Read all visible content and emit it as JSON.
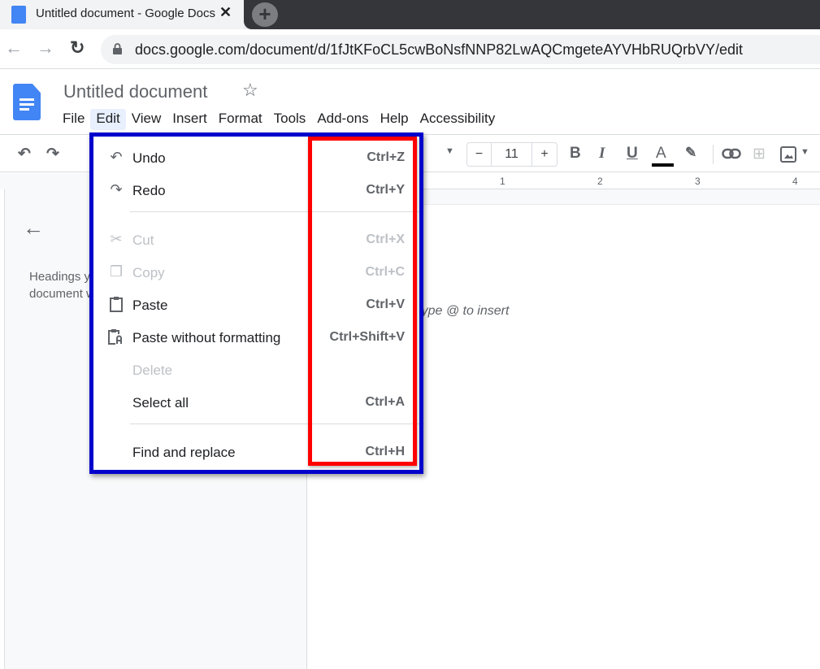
{
  "browser": {
    "tab_title": "Untitled document - Google Docs",
    "new_tab": "+",
    "close": "✕",
    "back": "←",
    "forward": "→",
    "reload": "↻",
    "url": "docs.google.com/document/d/1fJtKFoCL5cwBoNsfNNP82LwAQCmgeteAYVHbRUQrbVY/edit"
  },
  "doc": {
    "title": "Untitled document",
    "star": "☆",
    "menu": [
      "File",
      "Edit",
      "View",
      "Insert",
      "Format",
      "Tools",
      "Add-ons",
      "Help",
      "Accessibility"
    ],
    "active_menu": "Edit"
  },
  "toolbar": {
    "undo": "↶",
    "redo": "↷",
    "font_size": "11",
    "minus": "−",
    "plus": "+",
    "bold": "B",
    "italic": "I",
    "underline": "U",
    "text_color": "A",
    "text_color_value": "#000000"
  },
  "ruler": [
    "1",
    "2",
    "3",
    "4"
  ],
  "sidebar": {
    "back": "←",
    "hint": "Headings you add to the document will appear here."
  },
  "page": {
    "placeholder": "Type @ to insert"
  },
  "edit_menu": {
    "items": [
      {
        "label": "Undo",
        "shortcut": "Ctrl+Z",
        "icon": "undo-icon",
        "enabled": true
      },
      {
        "label": "Redo",
        "shortcut": "Ctrl+Y",
        "icon": "redo-icon",
        "enabled": true
      },
      {
        "label": "Cut",
        "shortcut": "Ctrl+X",
        "icon": "scissors-icon",
        "enabled": false
      },
      {
        "label": "Copy",
        "shortcut": "Ctrl+C",
        "icon": "copy-icon",
        "enabled": false
      },
      {
        "label": "Paste",
        "shortcut": "Ctrl+V",
        "icon": "clipboard-icon",
        "enabled": true
      },
      {
        "label": "Paste without formatting",
        "shortcut": "Ctrl+Shift+V",
        "icon": "clipboard-text-icon",
        "enabled": true
      },
      {
        "label": "Delete",
        "shortcut": "",
        "icon": "",
        "enabled": false
      },
      {
        "label": "Select all",
        "shortcut": "Ctrl+A",
        "icon": "",
        "enabled": true
      },
      {
        "label": "Find and replace",
        "shortcut": "Ctrl+H",
        "icon": "",
        "enabled": true
      }
    ]
  },
  "annotation_colors": {
    "menu_box": "#0000cc",
    "shortcut_box": "#ff0000"
  }
}
